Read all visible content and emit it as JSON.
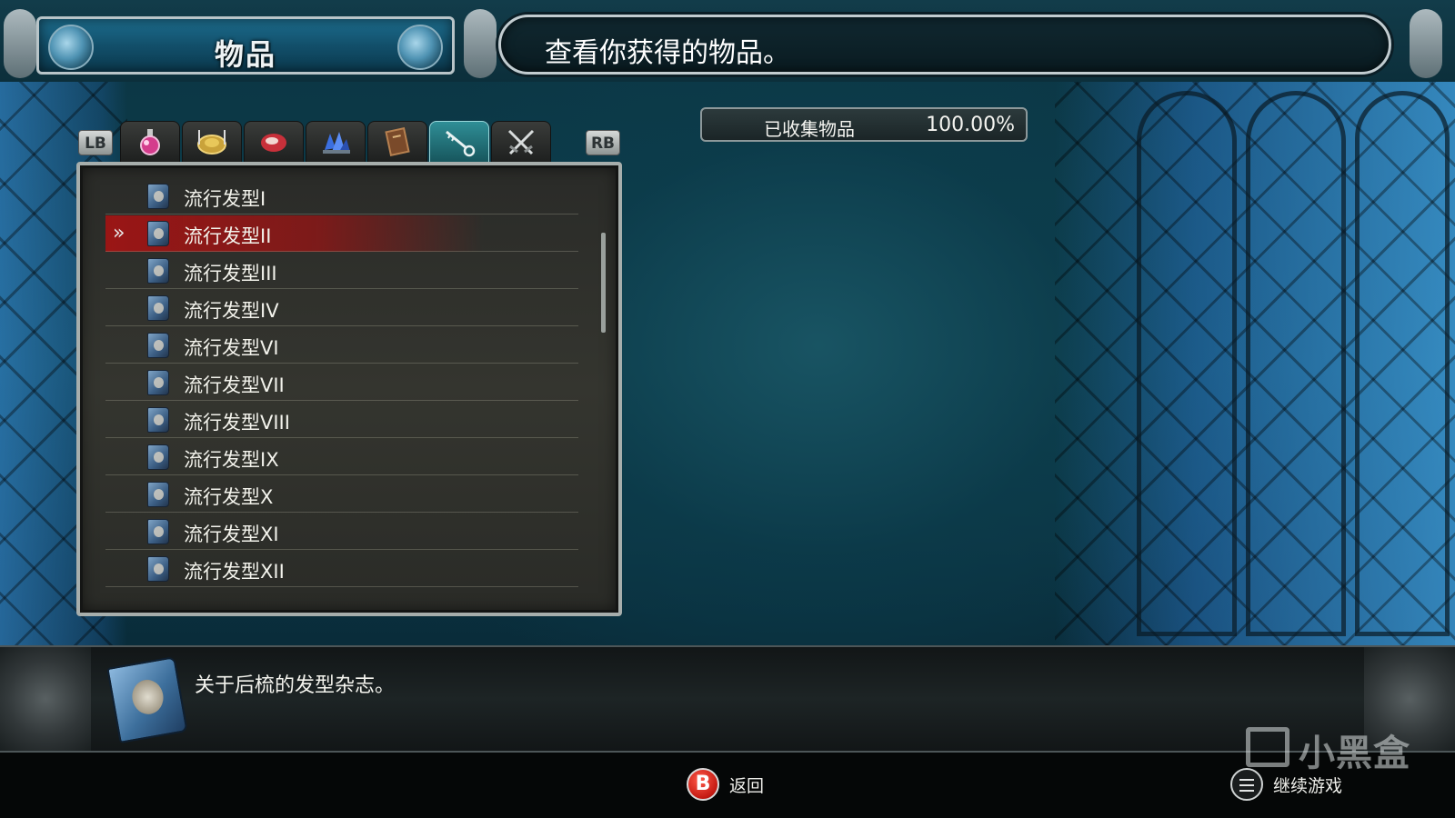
{
  "header": {
    "title": "物品",
    "info": "查看你获得的物品。"
  },
  "collected": {
    "label": "已收集物品",
    "value": "100.00%"
  },
  "tabs": {
    "left_bumper": "LB",
    "right_bumper": "RB",
    "items": [
      {
        "icon": "potion-icon",
        "active": false
      },
      {
        "icon": "food-plate-icon",
        "active": false
      },
      {
        "icon": "meat-icon",
        "active": false
      },
      {
        "icon": "crystal-ore-icon",
        "active": false
      },
      {
        "icon": "book-icon",
        "active": false
      },
      {
        "icon": "key-icon",
        "active": true
      },
      {
        "icon": "crossed-swords-icon",
        "active": false
      }
    ]
  },
  "list": {
    "selected_index": 1,
    "items": [
      {
        "name": "流行发型I"
      },
      {
        "name": "流行发型II"
      },
      {
        "name": "流行发型III"
      },
      {
        "name": "流行发型IV"
      },
      {
        "name": "流行发型VI"
      },
      {
        "name": "流行发型VII"
      },
      {
        "name": "流行发型VIII"
      },
      {
        "name": "流行发型IX"
      },
      {
        "name": "流行发型X"
      },
      {
        "name": "流行发型XI"
      },
      {
        "name": "流行发型XII"
      }
    ]
  },
  "description": {
    "text": "关于后梳的发型杂志。",
    "icon": "hair-magazine-icon"
  },
  "footer": {
    "back_button": "B",
    "back_label": "返回",
    "continue_label": "继续游戏",
    "continue_icon": "menu-icon"
  },
  "watermark": "小黑盒",
  "colors": {
    "selected_row": "#a01414",
    "active_tab": "#2f8e96",
    "b_button": "#c41a12"
  }
}
